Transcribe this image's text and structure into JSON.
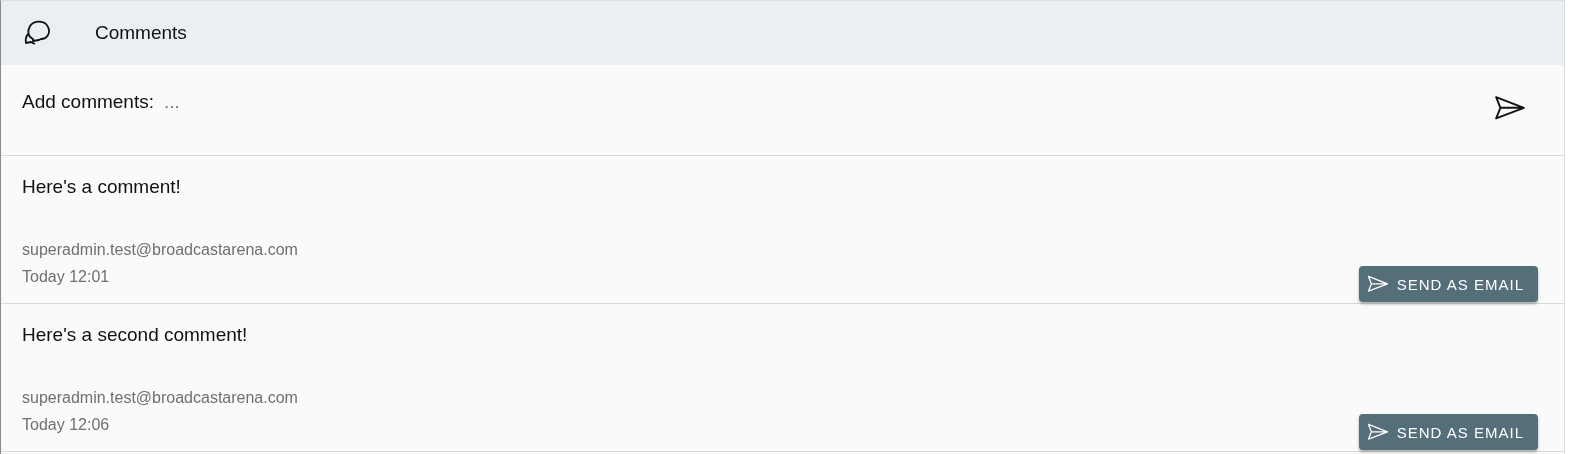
{
  "header": {
    "title": "Comments"
  },
  "new_comment": {
    "label": "Add comments:",
    "placeholder": "..."
  },
  "comments": [
    {
      "text": "Here's a comment!",
      "author": "superadmin.test@broadcastarena.com",
      "time": "Today 12:01",
      "button": "SEND AS EMAIL"
    },
    {
      "text": "Here's a second comment!",
      "author": "superadmin.test@broadcastarena.com",
      "time": "Today 12:06",
      "button": "SEND AS EMAIL"
    }
  ]
}
